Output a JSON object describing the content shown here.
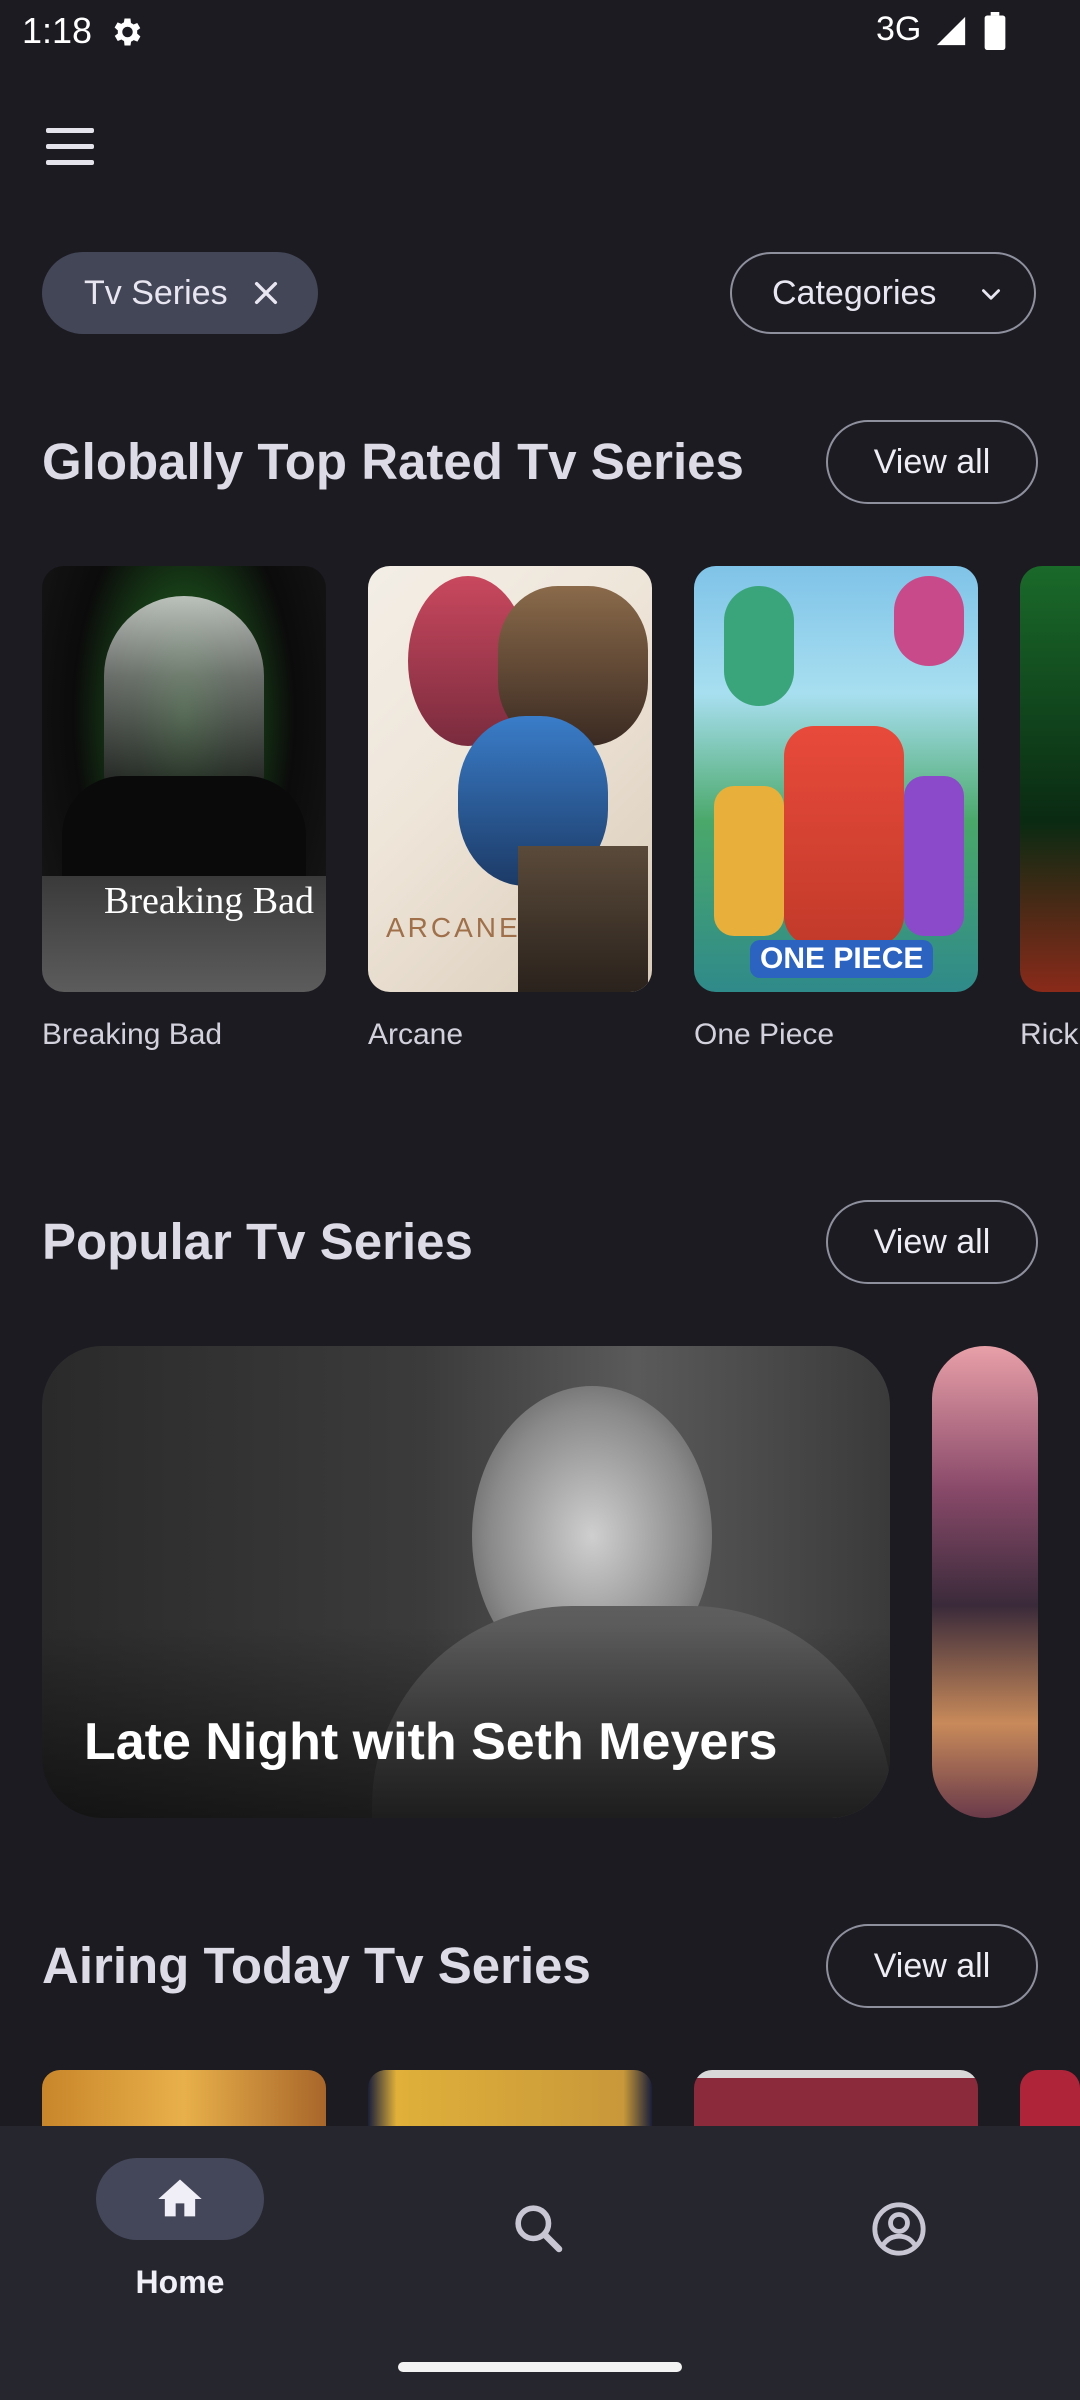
{
  "status_bar": {
    "time": "1:18",
    "network": "3G"
  },
  "filters": {
    "active_chip": "Tv Series",
    "categories_label": "Categories"
  },
  "sections": {
    "top_rated": {
      "title": "Globally Top Rated Tv Series",
      "view_all": "View all",
      "items": [
        {
          "title": "Breaking Bad",
          "poster_text": "Breaking Bad"
        },
        {
          "title": "Arcane",
          "poster_text": "ARCANE"
        },
        {
          "title": "One Piece",
          "poster_text": "ONE PIECE"
        },
        {
          "title": "Rick"
        }
      ]
    },
    "popular": {
      "title": "Popular Tv Series",
      "view_all": "View all",
      "featured": "Late Night with Seth Meyers"
    },
    "airing_today": {
      "title": "Airing Today Tv Series",
      "view_all": "View all"
    }
  },
  "bottom_nav": {
    "home_label": "Home"
  },
  "colors": {
    "background": "#1b1b21",
    "chip": "#434657",
    "nav": "#25262e"
  }
}
